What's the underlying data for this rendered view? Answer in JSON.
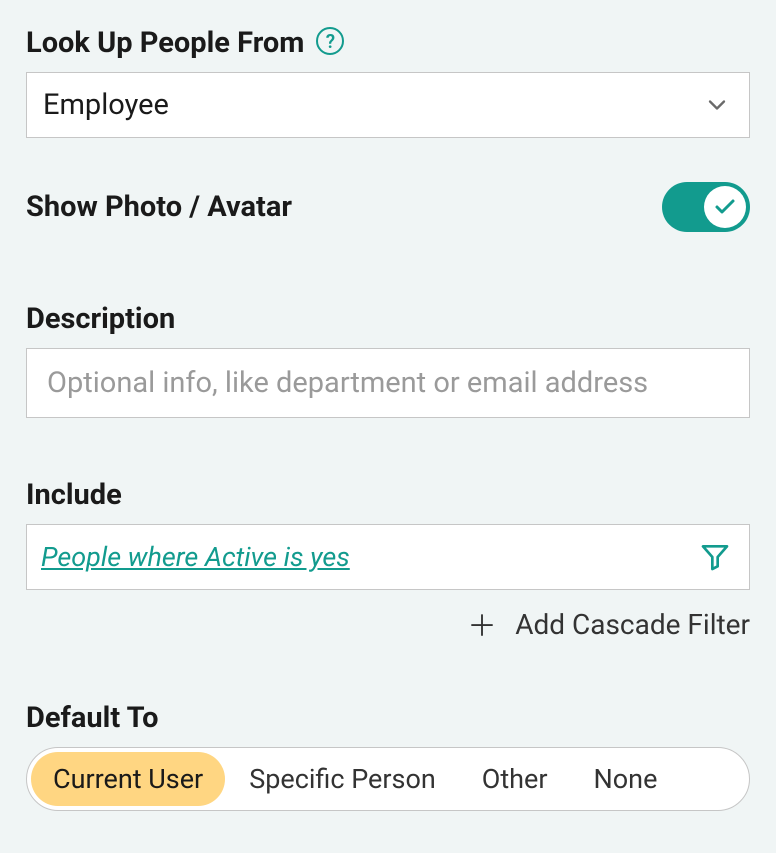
{
  "lookup": {
    "label": "Look Up People From",
    "value": "Employee"
  },
  "avatar": {
    "label": "Show Photo / Avatar",
    "enabled": true
  },
  "description": {
    "label": "Description",
    "placeholder": "Optional info, like department or email address"
  },
  "include": {
    "label": "Include",
    "filter_text": "People where Active is yes",
    "cascade_label": "Add Cascade Filter"
  },
  "default_to": {
    "label": "Default To",
    "options": [
      "Current User",
      "Specific Person",
      "Other",
      "None"
    ],
    "selected": "Current User"
  }
}
